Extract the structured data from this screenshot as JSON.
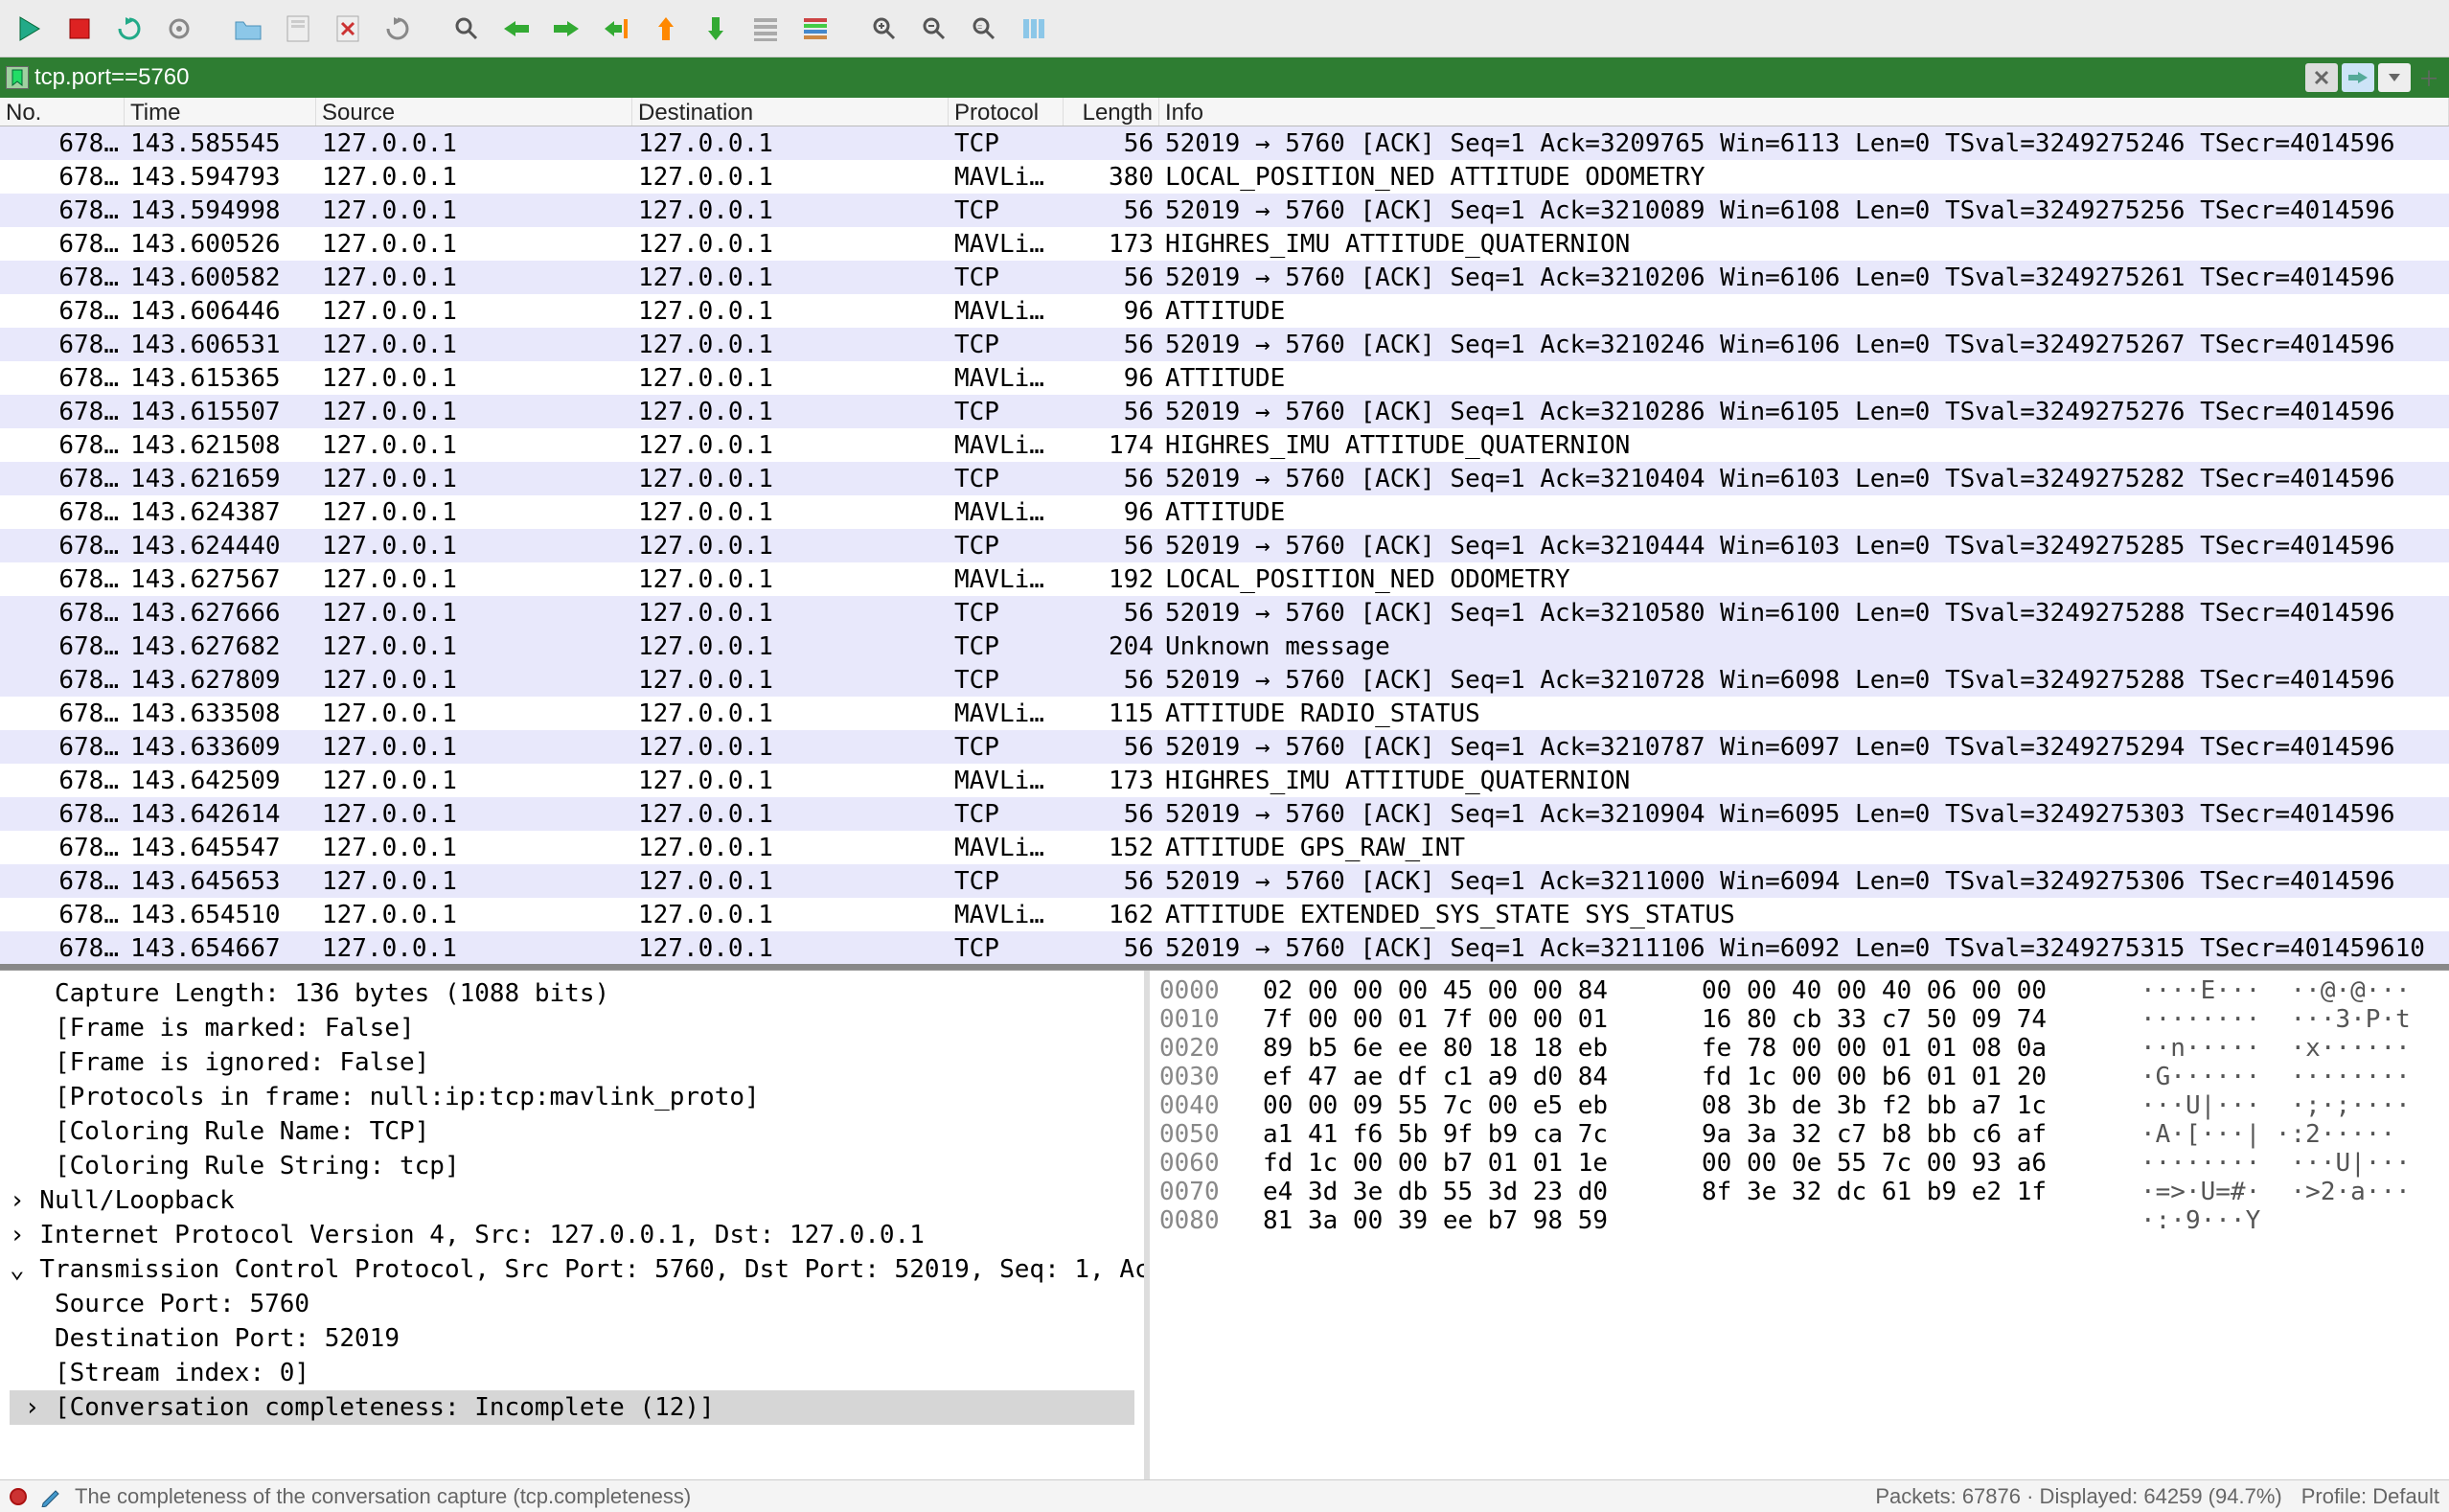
{
  "filter": {
    "value": "tcp.port==5760"
  },
  "columns": {
    "no": "No.",
    "time": "Time",
    "src": "Source",
    "dst": "Destination",
    "proto": "Protocol",
    "len": "Length",
    "info": "Info"
  },
  "packets": [
    {
      "no": "678…",
      "time": "143.585545",
      "src": "127.0.0.1",
      "dst": "127.0.0.1",
      "proto": "TCP",
      "len": "56",
      "info": "52019 → 5760 [ACK] Seq=1 Ack=3209765 Win=6113 Len=0 TSval=3249275246 TSecr=4014596",
      "cls": "tcp"
    },
    {
      "no": "678…",
      "time": "143.594793",
      "src": "127.0.0.1",
      "dst": "127.0.0.1",
      "proto": "MAVLi…",
      "len": "380",
      "info": "LOCAL_POSITION_NED   ATTITUDE   ODOMETRY",
      "cls": "mav"
    },
    {
      "no": "678…",
      "time": "143.594998",
      "src": "127.0.0.1",
      "dst": "127.0.0.1",
      "proto": "TCP",
      "len": "56",
      "info": "52019 → 5760 [ACK] Seq=1 Ack=3210089 Win=6108 Len=0 TSval=3249275256 TSecr=4014596",
      "cls": "tcp"
    },
    {
      "no": "678…",
      "time": "143.600526",
      "src": "127.0.0.1",
      "dst": "127.0.0.1",
      "proto": "MAVLi…",
      "len": "173",
      "info": "HIGHRES_IMU   ATTITUDE_QUATERNION",
      "cls": "mav"
    },
    {
      "no": "678…",
      "time": "143.600582",
      "src": "127.0.0.1",
      "dst": "127.0.0.1",
      "proto": "TCP",
      "len": "56",
      "info": "52019 → 5760 [ACK] Seq=1 Ack=3210206 Win=6106 Len=0 TSval=3249275261 TSecr=4014596",
      "cls": "tcp"
    },
    {
      "no": "678…",
      "time": "143.606446",
      "src": "127.0.0.1",
      "dst": "127.0.0.1",
      "proto": "MAVLi…",
      "len": "96",
      "info": "ATTITUDE",
      "cls": "mav"
    },
    {
      "no": "678…",
      "time": "143.606531",
      "src": "127.0.0.1",
      "dst": "127.0.0.1",
      "proto": "TCP",
      "len": "56",
      "info": "52019 → 5760 [ACK] Seq=1 Ack=3210246 Win=6106 Len=0 TSval=3249275267 TSecr=4014596",
      "cls": "tcp"
    },
    {
      "no": "678…",
      "time": "143.615365",
      "src": "127.0.0.1",
      "dst": "127.0.0.1",
      "proto": "MAVLi…",
      "len": "96",
      "info": "ATTITUDE",
      "cls": "mav"
    },
    {
      "no": "678…",
      "time": "143.615507",
      "src": "127.0.0.1",
      "dst": "127.0.0.1",
      "proto": "TCP",
      "len": "56",
      "info": "52019 → 5760 [ACK] Seq=1 Ack=3210286 Win=6105 Len=0 TSval=3249275276 TSecr=4014596",
      "cls": "tcp"
    },
    {
      "no": "678…",
      "time": "143.621508",
      "src": "127.0.0.1",
      "dst": "127.0.0.1",
      "proto": "MAVLi…",
      "len": "174",
      "info": "HIGHRES_IMU   ATTITUDE_QUATERNION",
      "cls": "mav"
    },
    {
      "no": "678…",
      "time": "143.621659",
      "src": "127.0.0.1",
      "dst": "127.0.0.1",
      "proto": "TCP",
      "len": "56",
      "info": "52019 → 5760 [ACK] Seq=1 Ack=3210404 Win=6103 Len=0 TSval=3249275282 TSecr=4014596",
      "cls": "tcp"
    },
    {
      "no": "678…",
      "time": "143.624387",
      "src": "127.0.0.1",
      "dst": "127.0.0.1",
      "proto": "MAVLi…",
      "len": "96",
      "info": "ATTITUDE",
      "cls": "mav"
    },
    {
      "no": "678…",
      "time": "143.624440",
      "src": "127.0.0.1",
      "dst": "127.0.0.1",
      "proto": "TCP",
      "len": "56",
      "info": "52019 → 5760 [ACK] Seq=1 Ack=3210444 Win=6103 Len=0 TSval=3249275285 TSecr=4014596",
      "cls": "tcp"
    },
    {
      "no": "678…",
      "time": "143.627567",
      "src": "127.0.0.1",
      "dst": "127.0.0.1",
      "proto": "MAVLi…",
      "len": "192",
      "info": "LOCAL_POSITION_NED   ODOMETRY",
      "cls": "mav"
    },
    {
      "no": "678…",
      "time": "143.627666",
      "src": "127.0.0.1",
      "dst": "127.0.0.1",
      "proto": "TCP",
      "len": "56",
      "info": "52019 → 5760 [ACK] Seq=1 Ack=3210580 Win=6100 Len=0 TSval=3249275288 TSecr=4014596",
      "cls": "tcp"
    },
    {
      "no": "678…",
      "time": "143.627682",
      "src": "127.0.0.1",
      "dst": "127.0.0.1",
      "proto": "TCP",
      "len": "204",
      "info": "Unknown message",
      "cls": "tcp"
    },
    {
      "no": "678…",
      "time": "143.627809",
      "src": "127.0.0.1",
      "dst": "127.0.0.1",
      "proto": "TCP",
      "len": "56",
      "info": "52019 → 5760 [ACK] Seq=1 Ack=3210728 Win=6098 Len=0 TSval=3249275288 TSecr=4014596",
      "cls": "tcp"
    },
    {
      "no": "678…",
      "time": "143.633508",
      "src": "127.0.0.1",
      "dst": "127.0.0.1",
      "proto": "MAVLi…",
      "len": "115",
      "info": "ATTITUDE   RADIO_STATUS",
      "cls": "mav"
    },
    {
      "no": "678…",
      "time": "143.633609",
      "src": "127.0.0.1",
      "dst": "127.0.0.1",
      "proto": "TCP",
      "len": "56",
      "info": "52019 → 5760 [ACK] Seq=1 Ack=3210787 Win=6097 Len=0 TSval=3249275294 TSecr=4014596",
      "cls": "tcp"
    },
    {
      "no": "678…",
      "time": "143.642509",
      "src": "127.0.0.1",
      "dst": "127.0.0.1",
      "proto": "MAVLi…",
      "len": "173",
      "info": "HIGHRES_IMU   ATTITUDE_QUATERNION",
      "cls": "mav"
    },
    {
      "no": "678…",
      "time": "143.642614",
      "src": "127.0.0.1",
      "dst": "127.0.0.1",
      "proto": "TCP",
      "len": "56",
      "info": "52019 → 5760 [ACK] Seq=1 Ack=3210904 Win=6095 Len=0 TSval=3249275303 TSecr=4014596",
      "cls": "tcp"
    },
    {
      "no": "678…",
      "time": "143.645547",
      "src": "127.0.0.1",
      "dst": "127.0.0.1",
      "proto": "MAVLi…",
      "len": "152",
      "info": "ATTITUDE   GPS_RAW_INT",
      "cls": "mav"
    },
    {
      "no": "678…",
      "time": "143.645653",
      "src": "127.0.0.1",
      "dst": "127.0.0.1",
      "proto": "TCP",
      "len": "56",
      "info": "52019 → 5760 [ACK] Seq=1 Ack=3211000 Win=6094 Len=0 TSval=3249275306 TSecr=4014596",
      "cls": "tcp"
    },
    {
      "no": "678…",
      "time": "143.654510",
      "src": "127.0.0.1",
      "dst": "127.0.0.1",
      "proto": "MAVLi…",
      "len": "162",
      "info": "ATTITUDE   EXTENDED_SYS_STATE   SYS_STATUS",
      "cls": "mav"
    },
    {
      "no": "678…",
      "time": "143.654667",
      "src": "127.0.0.1",
      "dst": "127.0.0.1",
      "proto": "TCP",
      "len": "56",
      "info": "52019 → 5760 [ACK] Seq=1 Ack=3211106 Win=6092 Len=0 TSval=3249275315 TSecr=401459610",
      "cls": "tcp"
    }
  ],
  "details": [
    "   Capture Length: 136 bytes (1088 bits)",
    "   [Frame is marked: False]",
    "   [Frame is ignored: False]",
    "   [Protocols in frame: null:ip:tcp:mavlink_proto]",
    "   [Coloring Rule Name: TCP]",
    "   [Coloring Rule String: tcp]",
    "› Null/Loopback",
    "› Internet Protocol Version 4, Src: 127.0.0.1, Dst: 127.0.0.1",
    "⌄ Transmission Control Protocol, Src Port: 5760, Dst Port: 52019, Seq: 1, Ac",
    "   Source Port: 5760",
    "   Destination Port: 52019",
    "   [Stream index: 0]",
    " › [Conversation completeness: Incomplete (12)]"
  ],
  "hex": [
    {
      "off": "0000",
      "b1": "02 00 00 00 45 00 00 84",
      "b2": "00 00 40 00 40 06 00 00",
      "asc": "····E···  ··@·@···"
    },
    {
      "off": "0010",
      "b1": "7f 00 00 01 7f 00 00 01",
      "b2": "16 80 cb 33 c7 50 09 74",
      "asc": "········  ···3·P·t"
    },
    {
      "off": "0020",
      "b1": "89 b5 6e ee 80 18 18 eb",
      "b2": "fe 78 00 00 01 01 08 0a",
      "asc": "··n·····  ·x······"
    },
    {
      "off": "0030",
      "b1": "ef 47 ae df c1 a9 d0 84",
      "b2": "fd 1c 00 00 b6 01 01 20",
      "asc": "·G······  ········"
    },
    {
      "off": "0040",
      "b1": "00 00 09 55 7c 00 e5 eb",
      "b2": "08 3b de 3b f2 bb a7 1c",
      "asc": "···U|···  ·;·;····"
    },
    {
      "off": "0050",
      "b1": "a1 41 f6 5b 9f b9 ca 7c",
      "b2": "9a 3a 32 c7 b8 bb c6 af",
      "asc": "·A·[···| ·:2·····"
    },
    {
      "off": "0060",
      "b1": "fd 1c 00 00 b7 01 01 1e",
      "b2": "00 00 0e 55 7c 00 93 a6",
      "asc": "········  ···U|···"
    },
    {
      "off": "0070",
      "b1": "e4 3d 3e db 55 3d 23 d0",
      "b2": "8f 3e 32 dc 61 b9 e2 1f",
      "asc": "·=>·U=#·  ·>2·a···"
    },
    {
      "off": "0080",
      "b1": "81 3a 00 39 ee b7 98 59",
      "b2": "",
      "asc": "·:·9···Y"
    }
  ],
  "status": {
    "hint": "The completeness of the conversation capture (tcp.completeness)",
    "packets": "Packets: 67876 · Displayed: 64259 (94.7%)",
    "profile": "Profile: Default"
  }
}
